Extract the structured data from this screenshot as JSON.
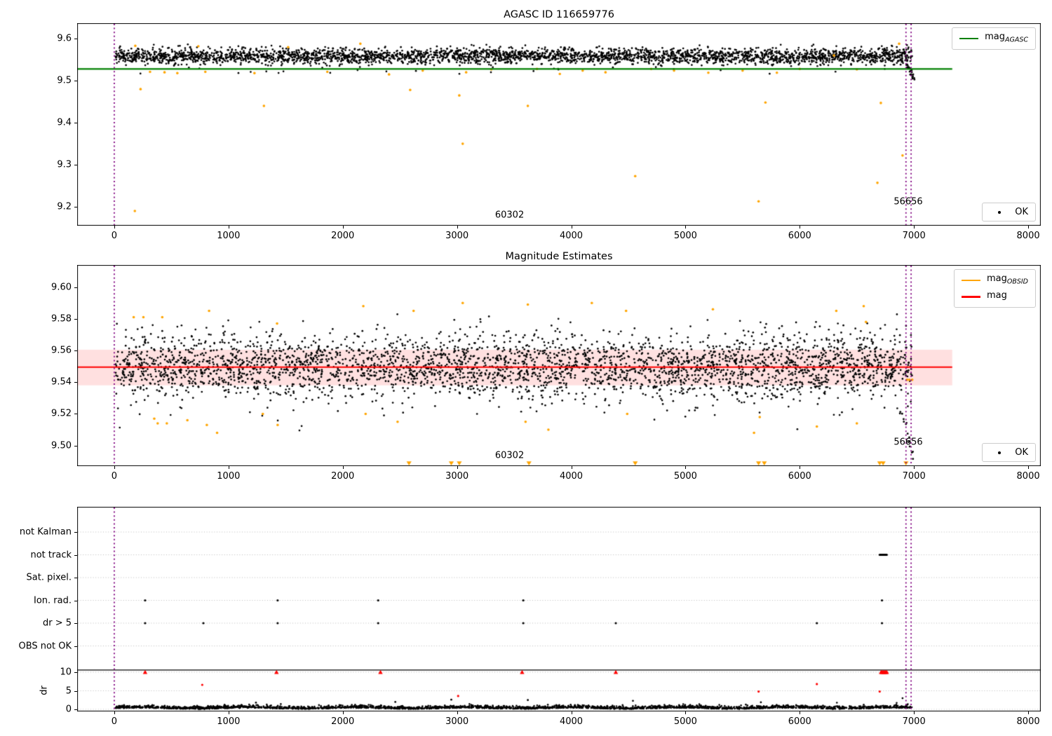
{
  "chart_data": [
    {
      "id": "mag-agasc",
      "type": "scatter",
      "title": "AGASC ID 116659776",
      "xlim": [
        -325,
        8110
      ],
      "ylim": [
        9.155,
        9.637
      ],
      "xticks": [
        0,
        1000,
        2000,
        3000,
        4000,
        5000,
        6000,
        7000,
        8000
      ],
      "yticks": [
        9.2,
        9.3,
        9.4,
        9.5,
        9.6
      ],
      "ytick_labels": [
        "9.2",
        "9.3",
        "9.4",
        "9.5",
        "9.6"
      ],
      "ref_line": {
        "y": 9.528,
        "color": "#008000",
        "x_start": -325,
        "x_end": 7335,
        "label": "mag",
        "sublabel": "AGASC"
      },
      "vlines": {
        "x": [
          0,
          6930,
          6975
        ],
        "color": "#800080",
        "style": "dotted"
      },
      "scatter_band": {
        "n": 3200,
        "x_range": [
          10,
          6985
        ],
        "y_center": 9.5585,
        "y_sigma": 0.0095,
        "y_clip": [
          9.5345,
          9.5865
        ],
        "seed": 42,
        "color": "#000000"
      },
      "below_band_black": {
        "n": 28,
        "x_range": [
          150,
          6900
        ],
        "y_range": [
          9.516,
          9.533
        ],
        "seed": 7
      },
      "tail": {
        "x_range": [
          6940,
          7000
        ],
        "y_from": 9.54,
        "y_to": 9.504,
        "n": 22,
        "seed": 11
      },
      "orange_color": "#ffa500",
      "orange_points": [
        [
          184,
          9.583
        ],
        [
          313,
          9.521
        ],
        [
          552,
          9.518
        ],
        [
          736,
          9.582
        ],
        [
          797,
          9.521
        ],
        [
          1227,
          9.518
        ],
        [
          1522,
          9.58
        ],
        [
          1865,
          9.521
        ],
        [
          2154,
          9.588
        ],
        [
          2405,
          9.515
        ],
        [
          2700,
          9.524
        ],
        [
          3080,
          9.52
        ],
        [
          3300,
          9.527
        ],
        [
          3700,
          9.528
        ],
        [
          3900,
          9.516
        ],
        [
          4100,
          9.524
        ],
        [
          4300,
          9.52
        ],
        [
          4700,
          9.528
        ],
        [
          4900,
          9.524
        ],
        [
          5200,
          9.519
        ],
        [
          5500,
          9.524
        ],
        [
          5800,
          9.519
        ],
        [
          6000,
          9.528
        ],
        [
          6300,
          9.56
        ],
        [
          6500,
          9.527
        ],
        [
          6870,
          9.588
        ],
        [
          180,
          9.19
        ],
        [
          230,
          9.48
        ],
        [
          440,
          9.52
        ],
        [
          1310,
          9.44
        ],
        [
          2590,
          9.478
        ],
        [
          3020,
          9.465
        ],
        [
          3050,
          9.35
        ],
        [
          3620,
          9.44
        ],
        [
          4560,
          9.273
        ],
        [
          5640,
          9.213
        ],
        [
          5700,
          9.448
        ],
        [
          6680,
          9.257
        ],
        [
          6710,
          9.447
        ],
        [
          6900,
          9.322
        ]
      ],
      "annotations": [
        {
          "text": "60302",
          "x": 3460,
          "y": 9.18
        },
        {
          "text": "56656",
          "x": 6950,
          "y": 9.212
        }
      ],
      "ok_legend": "OK"
    },
    {
      "id": "magnitude-estimates",
      "type": "scatter",
      "title": "Magnitude Estimates",
      "xlim": [
        -325,
        8110
      ],
      "ylim": [
        9.487,
        9.614
      ],
      "xticks": [
        0,
        1000,
        2000,
        3000,
        4000,
        5000,
        6000,
        7000,
        8000
      ],
      "yticks": [
        9.5,
        9.52,
        9.54,
        9.56,
        9.58,
        9.6
      ],
      "ytick_labels": [
        "9.50",
        "9.52",
        "9.54",
        "9.56",
        "9.58",
        "9.60"
      ],
      "ref_line": {
        "y": 9.5495,
        "color": "#ff0000",
        "x_start": -325,
        "x_end": 7335,
        "label": "mag",
        "sublabel": ""
      },
      "band": {
        "y0": 9.538,
        "y1": 9.5605,
        "x_start": -325,
        "x_end": 7335,
        "color": "rgba(255,0,0,0.12)"
      },
      "legend": [
        {
          "label": "mag",
          "sublabel": "OBSID",
          "color": "#ffa500"
        },
        {
          "label": "mag",
          "sublabel": "",
          "color": "#ff0000"
        }
      ],
      "vlines": {
        "x": [
          0,
          6930,
          6975
        ],
        "color": "#800080",
        "style": "dotted"
      },
      "scatter_band": {
        "n": 3400,
        "x_range": [
          10,
          6985
        ],
        "y_center": 9.5495,
        "y_sigma": 0.0105,
        "y_clip": [
          9.509,
          9.5835
        ],
        "seed": 77,
        "color": "#000000"
      },
      "tail": {
        "x_range": [
          6880,
          7000
        ],
        "y_from": 9.525,
        "y_to": 9.489,
        "n": 16,
        "seed": 5
      },
      "orange_color": "#ffa500",
      "orange_points": [
        [
          170,
          9.581
        ],
        [
          255,
          9.581
        ],
        [
          420,
          9.581
        ],
        [
          350,
          9.517
        ],
        [
          380,
          9.514
        ],
        [
          460,
          9.514
        ],
        [
          640,
          9.516
        ],
        [
          810,
          9.513
        ],
        [
          900,
          9.508
        ],
        [
          830,
          9.585
        ],
        [
          1300,
          9.52
        ],
        [
          1425,
          9.577
        ],
        [
          1430,
          9.513
        ],
        [
          2180,
          9.588
        ],
        [
          2200,
          9.52
        ],
        [
          2480,
          9.515
        ],
        [
          2620,
          9.585
        ],
        [
          3050,
          9.59
        ],
        [
          3600,
          9.515
        ],
        [
          3620,
          9.589
        ],
        [
          3800,
          9.51
        ],
        [
          4180,
          9.59
        ],
        [
          4480,
          9.585
        ],
        [
          4490,
          9.52
        ],
        [
          5240,
          9.586
        ],
        [
          5600,
          9.508
        ],
        [
          5650,
          9.518
        ],
        [
          6150,
          9.512
        ],
        [
          6320,
          9.585
        ],
        [
          6500,
          9.514
        ],
        [
          6560,
          9.588
        ],
        [
          6580,
          9.578
        ],
        [
          6940,
          9.5415
        ],
        [
          6960,
          9.5415
        ],
        [
          6985,
          9.5415
        ]
      ],
      "orange_triangles_x": [
        2580,
        2950,
        3020,
        3630,
        4560,
        5640,
        5690,
        6700,
        6730,
        6930
      ],
      "annotations": [
        {
          "text": "60302",
          "x": 3460,
          "y": 9.4935
        },
        {
          "text": "56656",
          "x": 6950,
          "y": 9.502
        }
      ],
      "ok_legend": "OK"
    },
    {
      "id": "flags-dr",
      "type": "scatter",
      "rows": [
        "not Kalman",
        "not track",
        "Sat. pixel.",
        "Ion. rad.",
        "dr > 5",
        "OBS not OK"
      ],
      "dr_ticks": [
        10,
        5,
        0
      ],
      "dr_axis_label": "dr",
      "xticks": [
        0,
        1000,
        2000,
        3000,
        4000,
        5000,
        6000,
        7000,
        8000
      ],
      "xlim": [
        -325,
        8110
      ],
      "grid_color": "#bbbbbb",
      "hline_dr": 10.6,
      "vlines": {
        "x": [
          0,
          6930,
          6975
        ],
        "color": "#800080",
        "style": "dotted"
      },
      "flag_points": {
        "ion_rad_x": [
          270,
          1430,
          2310,
          3580,
          6720
        ],
        "dr_gt5_x": [
          270,
          780,
          1430,
          2310,
          3580,
          4390,
          6150,
          6720
        ]
      },
      "not_track_run": {
        "x0": 6700,
        "x1": 6762,
        "n": 16
      },
      "red_color": "#ff0000",
      "red_dr_points": [
        {
          "x": 270,
          "dr": 10,
          "clipped": true
        },
        {
          "x": 770,
          "dr": 6.6,
          "clipped": false
        },
        {
          "x": 1420,
          "dr": 10,
          "clipped": true
        },
        {
          "x": 2330,
          "dr": 10,
          "clipped": true
        },
        {
          "x": 3010,
          "dr": 3.6,
          "clipped": false
        },
        {
          "x": 3570,
          "dr": 10,
          "clipped": true
        },
        {
          "x": 4390,
          "dr": 10,
          "clipped": true
        },
        {
          "x": 5640,
          "dr": 4.8,
          "clipped": false
        },
        {
          "x": 6150,
          "dr": 6.8,
          "clipped": false
        },
        {
          "x": 6700,
          "dr": 4.8,
          "clipped": false
        },
        {
          "x": 6712,
          "dr": 10,
          "clipped": true
        },
        {
          "x": 6722,
          "dr": 10,
          "clipped": true
        },
        {
          "x": 6732,
          "dr": 10,
          "clipped": true
        },
        {
          "x": 6742,
          "dr": 10,
          "clipped": true
        },
        {
          "x": 6752,
          "dr": 10,
          "clipped": true
        },
        {
          "x": 6762,
          "dr": 10,
          "clipped": true
        }
      ],
      "black_dr_outliers": [
        [
          1240,
          1.8
        ],
        [
          2460,
          2.0
        ],
        [
          2950,
          2.6
        ],
        [
          3620,
          2.5
        ],
        [
          4540,
          2.3
        ],
        [
          5660,
          1.9
        ],
        [
          6900,
          3.0
        ]
      ],
      "dr_band": {
        "n": 2400,
        "x_range": [
          10,
          6985
        ],
        "seed": 99,
        "base": 0.25,
        "spread": 0.35,
        "wiggle": 0.15
      }
    }
  ]
}
